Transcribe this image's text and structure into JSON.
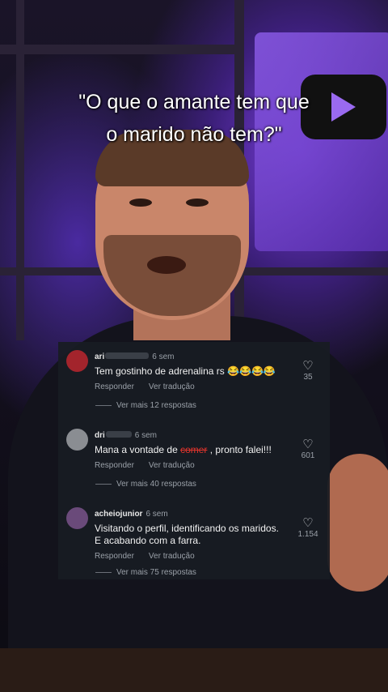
{
  "video": {
    "caption_line1": "\"O que o amante tem que",
    "caption_line2": "o marido não tem?\""
  },
  "comments": [
    {
      "username_visible": "ari",
      "time": "6 sem",
      "text": "Tem gostinho de adrenalina rs 😂😂😂😂",
      "reply_label": "Responder",
      "translate_label": "Ver tradução",
      "likes": "35",
      "more_replies": "Ver mais 12 respostas",
      "avatar_color": "#a3242c"
    },
    {
      "username_visible": "dri",
      "time": "6 sem",
      "text_before": "Mana a vontade de ",
      "text_struck": "comer",
      "text_after": " , pronto falei!!!",
      "reply_label": "Responder",
      "translate_label": "Ver tradução",
      "likes": "601",
      "more_replies": "Ver mais 40 respostas",
      "avatar_color": "#8a8d92"
    },
    {
      "username_visible": "acheiojunior",
      "time": "6 sem",
      "text_line1": "Visitando o perfil, identificando os maridos.",
      "text_line2": "E acabando com a farra.",
      "reply_label": "Responder",
      "translate_label": "Ver tradução",
      "likes": "1.154",
      "more_replies": "Ver mais 75 respostas",
      "avatar_color": "#6a4a7a"
    }
  ],
  "icons": {
    "like": "heart-icon"
  }
}
